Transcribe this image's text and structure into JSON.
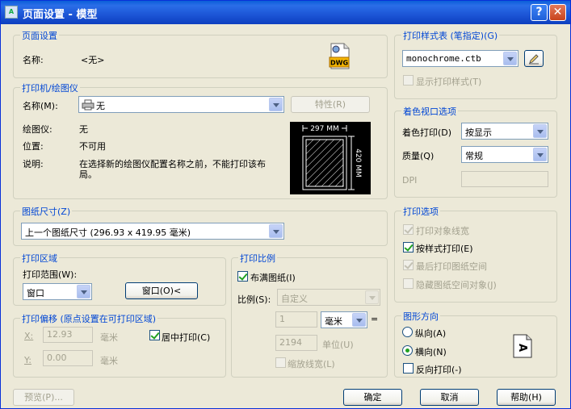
{
  "window": {
    "title": "页面设置 - 模型",
    "help": "?",
    "close": "✕",
    "app_icon": "A"
  },
  "page_setup": {
    "title": "页面设置",
    "name_label": "名称:",
    "name_value": "<无>",
    "icon_text": "DWG"
  },
  "printer": {
    "title": "打印机/绘图仪",
    "name_label": "名称(M):",
    "name_value": "无",
    "properties_button": "特性(R)",
    "plotter_label": "绘图仪:",
    "plotter_value": "无",
    "location_label": "位置:",
    "location_value": "不可用",
    "desc_label": "说明:",
    "desc_value_line1": "在选择新的绘图仪配置名称之前，不能打印该布",
    "desc_value_line2": "局。",
    "preview_width": "297 MM",
    "preview_height": "420 MM"
  },
  "paper_size": {
    "title": "图纸尺寸(Z)",
    "value": "上一个图纸尺寸 (296.93 x 419.95 毫米)"
  },
  "plot_area": {
    "title": "打印区域",
    "range_label": "打印范围(W):",
    "range_value": "窗口",
    "window_button": "窗口(O)<"
  },
  "plot_offset": {
    "title": "打印偏移 (原点设置在可打印区域)",
    "x_label": "X:",
    "x_value": "12.93",
    "x_unit": "毫米",
    "y_label": "Y:",
    "y_value": "0.00",
    "y_unit": "毫米",
    "center_label": "居中打印(C)",
    "center_checked": true
  },
  "plot_scale": {
    "title": "打印比例",
    "fit_label": "布满图纸(I)",
    "fit_checked": true,
    "scale_label": "比例(S):",
    "scale_value": "自定义",
    "value1": "1",
    "unit_value": "毫米",
    "equals": "=",
    "value2": "2194",
    "unit_label": "单位(U)",
    "lineweight_label": "缩放线宽(L)",
    "lineweight_checked": false
  },
  "plot_style": {
    "title": "打印样式表 (笔指定)(G)",
    "value": "monochrome.ctb",
    "show_label": "显示打印样式(T)",
    "show_checked": false
  },
  "shaded_viewport": {
    "title": "着色视口选项",
    "shade_label": "着色打印(D)",
    "shade_value": "按显示",
    "quality_label": "质量(Q)",
    "quality_value": "常规",
    "dpi_label": "DPI",
    "dpi_value": ""
  },
  "plot_options": {
    "title": "打印选项",
    "items": [
      {
        "label": "打印对象线宽",
        "checked": true,
        "disabled": true
      },
      {
        "label": "按样式打印(E)",
        "checked": true,
        "disabled": false
      },
      {
        "label": "最后打印图纸空间",
        "checked": true,
        "disabled": true
      },
      {
        "label": "隐藏图纸空间对象(J)",
        "checked": false,
        "disabled": true
      }
    ]
  },
  "orientation": {
    "title": "图形方向",
    "portrait_label": "纵向(A)",
    "landscape_label": "横向(N)",
    "selected": "landscape",
    "reverse_label": "反向打印(-)",
    "reverse_checked": false,
    "icon_text": "A"
  },
  "footer": {
    "preview": "预览(P)...",
    "ok": "确定",
    "cancel": "取消",
    "help": "帮助(H)"
  }
}
